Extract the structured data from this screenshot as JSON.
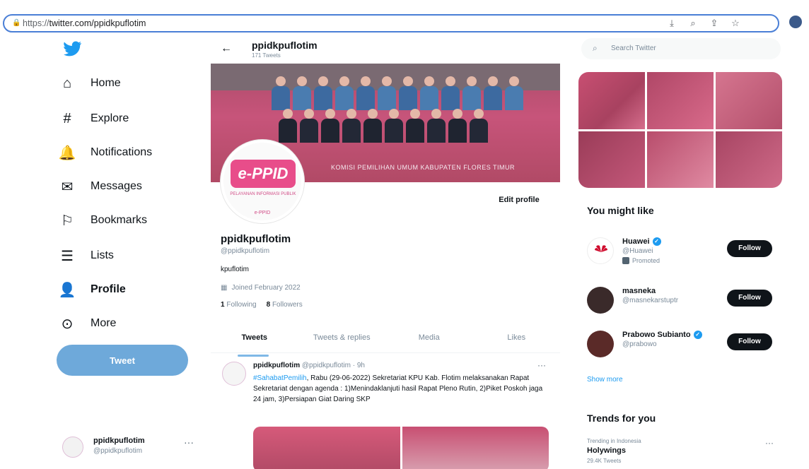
{
  "browser": {
    "url_proto": "https://",
    "url_rest": "twitter.com/ppidkpuflotim",
    "toolbar_icons": [
      "download-icon",
      "zoom-icon",
      "share-icon",
      "star-icon"
    ]
  },
  "sidebar": {
    "items": [
      {
        "label": "Home",
        "icon": "home-icon",
        "glyph": "⌂"
      },
      {
        "label": "Explore",
        "icon": "hashtag-icon",
        "glyph": "#"
      },
      {
        "label": "Notifications",
        "icon": "bell-icon",
        "glyph": "🔔"
      },
      {
        "label": "Messages",
        "icon": "envelope-icon",
        "glyph": "✉"
      },
      {
        "label": "Bookmarks",
        "icon": "bookmark-icon",
        "glyph": "⚐"
      },
      {
        "label": "Lists",
        "icon": "list-icon",
        "glyph": "☰"
      },
      {
        "label": "Profile",
        "icon": "person-icon",
        "glyph": "👤"
      },
      {
        "label": "More",
        "icon": "more-circle-icon",
        "glyph": "⊙"
      }
    ],
    "tweet_button": "Tweet",
    "account": {
      "name": "ppidkpuflotim",
      "handle": "@ppidkpuflotim",
      "menu": "···"
    }
  },
  "header": {
    "name": "ppidkpuflotim",
    "tweet_count": "171 Tweets"
  },
  "profile": {
    "logo_text": "e-PPID",
    "logo_subtitle": "PELAYANAN INFORMASI PUBLIK",
    "logo_bottom": "e-PPID",
    "edit_button": "Edit profile",
    "name": "ppidkpuflotim",
    "handle": "@ppidkpuflotim",
    "bio": "kpuflotim",
    "joined": "Joined February 2022",
    "following_count": "1",
    "following_label": "Following",
    "followers_count": "8",
    "followers_label": "Followers"
  },
  "banner_text": "KOMISI PEMILIHAN UMUM KABUPATEN FLORES TIMUR",
  "tabs": [
    {
      "label": "Tweets",
      "active": true
    },
    {
      "label": "Tweets & replies",
      "active": false
    },
    {
      "label": "Media",
      "active": false
    },
    {
      "label": "Likes",
      "active": false
    }
  ],
  "tweet": {
    "name": "ppidkpuflotim",
    "meta": "@ppidkpuflotim · 9h",
    "hashtag": "#SahabatPemilih",
    "text": ", Rabu (29-06-2022) Sekretariat KPU Kab. Flotim melaksanakan Rapat Sekretariat dengan agenda : 1)Menindaklanjuti hasil Rapat Pleno Rutin, 2)Piket Poskoh jaga 24 jam, 3)Persiapan Giat Daring SKP",
    "menu": "···"
  },
  "right": {
    "search_placeholder": "Search Twitter",
    "you_might_like": "You might like",
    "suggestions": [
      {
        "name": "Huawei",
        "handle": "@Huawei",
        "verified": true,
        "promoted": "Promoted",
        "follow": "Follow"
      },
      {
        "name": "masneka",
        "handle": "@masnekarstuptr",
        "verified": false,
        "promoted": "",
        "follow": "Follow"
      },
      {
        "name": "Prabowo Subianto",
        "handle": "@prabowo",
        "verified": true,
        "promoted": "",
        "follow": "Follow"
      }
    ],
    "show_more": "Show more",
    "trends_title": "Trends for you",
    "trend": {
      "meta": "Trending in Indonesia",
      "name": "Holywings",
      "count": "29.4K Tweets",
      "menu": "···"
    }
  },
  "colors": {
    "accent": "#1d9bf0",
    "tweet_button": "#6ea9da",
    "url_border": "#4a7fd6"
  }
}
